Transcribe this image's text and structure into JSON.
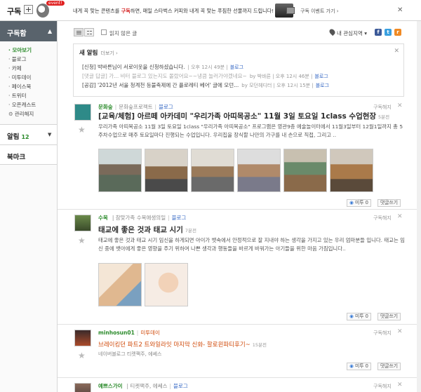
{
  "topbar": {
    "logo": "구독",
    "event_badge": "event!",
    "promo_prefix": "내게 꼭 맞는 콘텐츠를 ",
    "promo_highlight": "구독",
    "promo_suffix": "하면, 매일 스타벅스 커피와 내게 꼭 맞는 푸짐한 선물까지 드립니다!",
    "promo_link": "구독 이벤트 가기 ›"
  },
  "sidebar": {
    "header": "구독함",
    "items": [
      "· 모아보기",
      "· 블로그",
      "· 카페",
      "· 미투데이",
      "· 페이스북",
      "· 트위터",
      "· 오픈캐스트",
      "관리해지"
    ],
    "sections": [
      {
        "label": "알림",
        "count": "12"
      },
      {
        "label": "북마크",
        "count": ""
      }
    ]
  },
  "toolbar": {
    "unread_label": "읽지 않은 글",
    "location_label": "내 관심지역 ▾",
    "social": [
      "f",
      "t",
      "r"
    ]
  },
  "notice": {
    "title": "새 알림",
    "more": "더보기 ›",
    "rows": [
      {
        "text": "[신청] 박바른님이 서로이웃을 신청하셨습니다.",
        "meta": "| 오후 12시 49분 |",
        "blog": "블로그",
        "dim": false
      },
      {
        "text": "[댓글 답글] 가... 비터 블로그 있는지도 몰랐어요~~냉큼 놀러가야겠네요~",
        "meta": "by 박바른 | 오후 12시 46분 |",
        "blog": "블로그",
        "dim": true
      },
      {
        "text": "[공감] '2012년 서울 청계천 등불축제에 간 플로레티 베어' 글에 모던...",
        "meta": "by 모던헤디터 | 오후 12시 15분 |",
        "blog": "블로그",
        "dim": false
      }
    ]
  },
  "posts": [
    {
      "author": "문화숲",
      "desc": "문화숲프로젝트",
      "blog": "블로그",
      "unsub": "구독해지",
      "title": "[교육/체험] 아르떼 아카데미 \"우리가족 아띠목공소\" 11월 3일 토요일 1class 수업현장",
      "time": "5분전",
      "body": "우리가족 아띠목공소 11월 3일 토요일 1class \"우리가족 아띠목공소\" 프로그램은 영관9층 예술놀이터에서 11월3일부터 12월1일까지 총 5주차수업으로 매주 토요일마다 진행되는 수업입니다. 우리집을 장식할 나만의 가구를 내 손으로 직접, 그리고 ..",
      "me2": "미투",
      "me2_count": "0",
      "comment": "댓글쓰기"
    },
    {
      "author": "수목",
      "desc": "| 참맞가족 수목애생의일",
      "blog": "블로그",
      "unsub": "구독해지",
      "title": "태교에 좋은 것과 태교 시기",
      "time": "7분전",
      "body": "태교에 좋은 것과 태교 시기 임신을 하게되면 아이가 뱃속에서 안정적으로 잘 지내야 하는 생각을 가지고 있는 우리 엄마분들 입니다. 태교는 임신 중에 뱃아에게 좋은 영향을 주기 위하여 나쁜 생각과 행동들을 바르게 바꿔가는 아기들을 위한 마음 가짐입니다..",
      "me2": "미투",
      "me2_count": "0",
      "comment": "댓글쓰기"
    },
    {
      "author": "minhosun01",
      "desc": "",
      "blog": "미투데이",
      "unsub": "구독해지",
      "title": "브레이킹던 파트2 트와일라잇 마지막 신화- 할로윈파티후기~",
      "time": "15분전",
      "sub": "네이버블로그 티켓팩주, 에쎄스",
      "me2": "미투",
      "me2_count": "0",
      "comment": "댓글쓰기"
    },
    {
      "author": "예쁘스가이",
      "desc": "| 티켓팩주, 에쎄스",
      "blog": "블로그",
      "unsub": "구독해지",
      "title": "",
      "time": ""
    }
  ],
  "colors": {
    "accent_green": "#2a8a2a",
    "sidebar_header": "#59636c",
    "blog_link": "#3a6bc6",
    "promo_red": "#d42020"
  }
}
